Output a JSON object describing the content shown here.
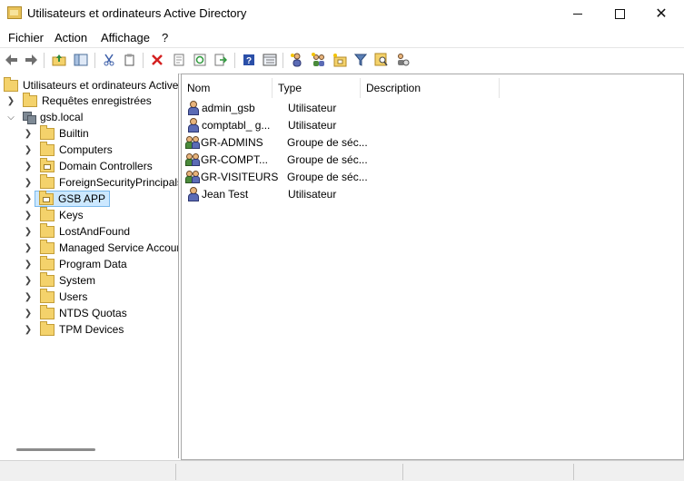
{
  "window": {
    "title": "Utilisateurs et ordinateurs Active Directory",
    "minimize_icon": "minimize-icon",
    "maximize_icon": "maximize-icon",
    "close_glyph": "✕"
  },
  "menu": [
    "Fichier",
    "Action",
    "Affichage",
    "?"
  ],
  "toolbar": {
    "icons": [
      "back-arrow-icon",
      "forward-arrow-icon",
      "up-folder-icon",
      "show-hide-console-tree-icon",
      "cut-icon",
      "copy-icon",
      "delete-icon",
      "properties-icon",
      "refresh-icon",
      "export-list-icon",
      "help-icon",
      "console-view-icon",
      "new-user-icon",
      "new-group-icon",
      "new-ou-icon",
      "filter-icon",
      "find-icon",
      "add-to-group-icon"
    ]
  },
  "tree": {
    "root": "Utilisateurs et ordinateurs Active",
    "saved_queries": "Requêtes enregistrées",
    "domain": "gsb.local",
    "children": [
      {
        "label": "Builtin",
        "type": "container"
      },
      {
        "label": "Computers",
        "type": "container"
      },
      {
        "label": "Domain Controllers",
        "type": "ou"
      },
      {
        "label": "ForeignSecurityPrincipals",
        "type": "container"
      },
      {
        "label": "GSB APP",
        "type": "ou",
        "selected": true
      },
      {
        "label": "Keys",
        "type": "container"
      },
      {
        "label": "LostAndFound",
        "type": "container"
      },
      {
        "label": "Managed Service Accour",
        "type": "container"
      },
      {
        "label": "Program Data",
        "type": "container"
      },
      {
        "label": "System",
        "type": "container"
      },
      {
        "label": "Users",
        "type": "container"
      },
      {
        "label": "NTDS Quotas",
        "type": "container"
      },
      {
        "label": "TPM Devices",
        "type": "container"
      }
    ]
  },
  "list": {
    "columns": [
      "Nom",
      "Type",
      "Description"
    ],
    "rows": [
      {
        "name": "admin_gsb",
        "type": "Utilisateur",
        "description": "",
        "kind": "user"
      },
      {
        "name": "comptabl_ g...",
        "type": "Utilisateur",
        "description": "",
        "kind": "user"
      },
      {
        "name": "GR-ADMINS",
        "type": "Groupe de séc...",
        "description": "",
        "kind": "group"
      },
      {
        "name": "GR-COMPT...",
        "type": "Groupe de séc...",
        "description": "",
        "kind": "group"
      },
      {
        "name": "GR-VISITEURS",
        "type": "Groupe de séc...",
        "description": "",
        "kind": "group"
      },
      {
        "name": "Jean Test",
        "type": "Utilisateur",
        "description": "",
        "kind": "user"
      }
    ]
  },
  "colors": {
    "selection_bg": "#cce8ff",
    "selection_border": "#7ab8ea",
    "folder": "#f4d26b"
  }
}
